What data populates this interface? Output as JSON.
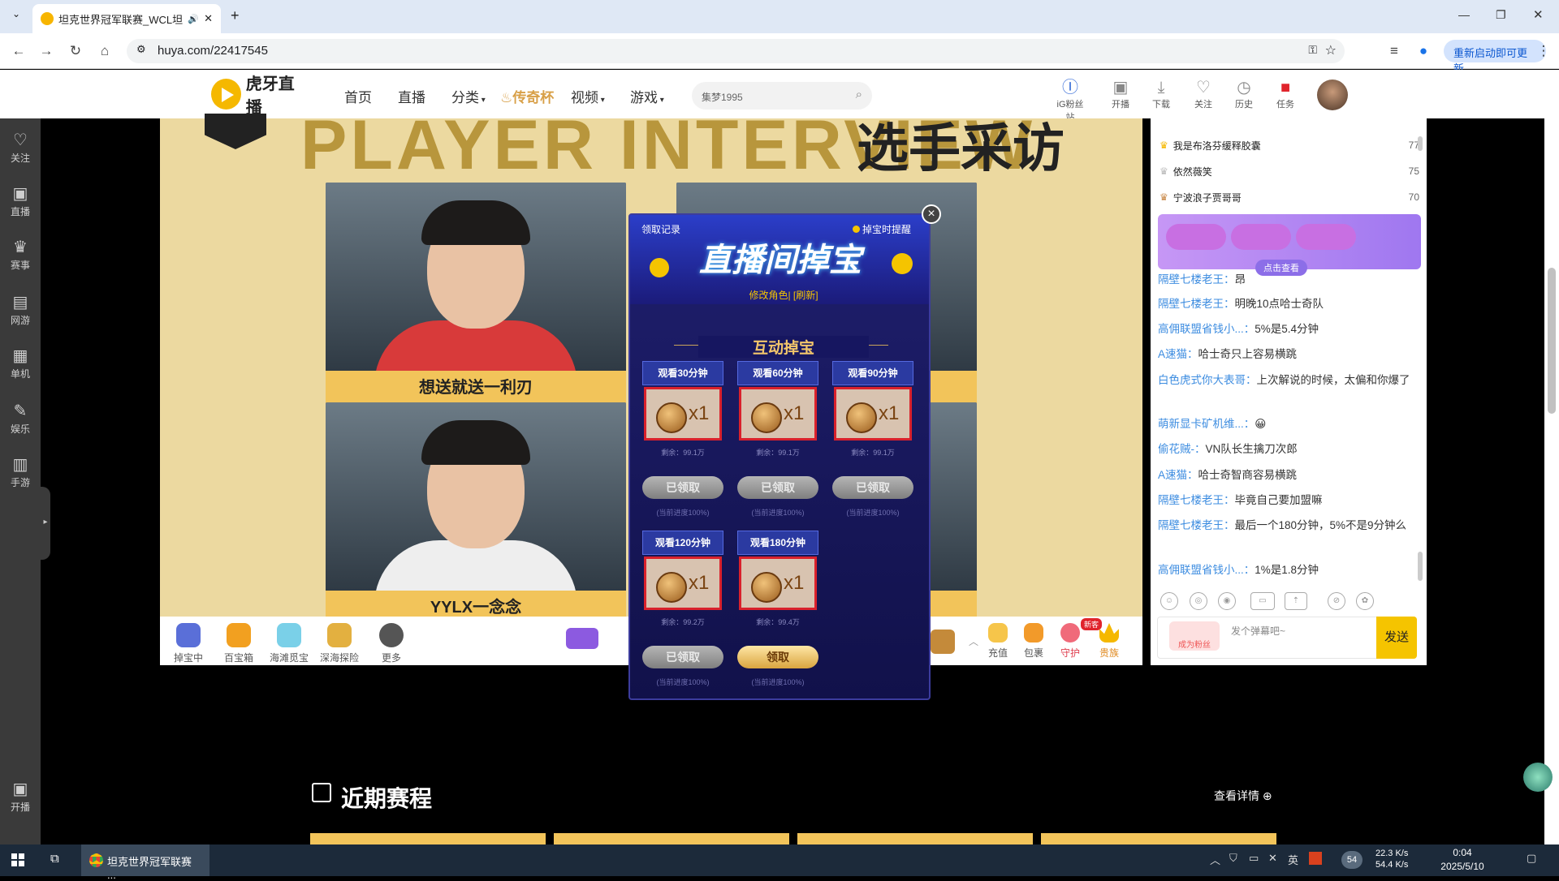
{
  "browser": {
    "tab_title": "坦克世界冠军联赛_WCL坦克",
    "url": "huya.com/22417545",
    "update_button": "重新启动即可更新"
  },
  "header": {
    "nav": [
      "首页",
      "直播",
      "分类",
      "传奇杯",
      "视频",
      "游戏"
    ],
    "search_placeholder": "集梦1995",
    "icons": [
      {
        "label": "iG粉丝站",
        "icon": "fan-icon"
      },
      {
        "label": "开播",
        "icon": "broadcast-icon"
      },
      {
        "label": "下载",
        "icon": "download-icon"
      },
      {
        "label": "关注",
        "icon": "heart-icon"
      },
      {
        "label": "历史",
        "icon": "history-icon"
      },
      {
        "label": "任务",
        "icon": "gift-icon"
      }
    ]
  },
  "sidebar": {
    "items": [
      {
        "label": "关注",
        "icon": "heart-icon"
      },
      {
        "label": "直播",
        "icon": "live-icon"
      },
      {
        "label": "赛事",
        "icon": "trophy-icon"
      },
      {
        "label": "网游",
        "icon": "gamepad-icon"
      },
      {
        "label": "单机",
        "icon": "console-icon"
      },
      {
        "label": "娱乐",
        "icon": "mic-icon"
      },
      {
        "label": "手游",
        "icon": "phone-game-icon"
      }
    ],
    "bottom": {
      "label": "开播",
      "icon": "broadcast-icon"
    }
  },
  "stage": {
    "cam1_caption": "想送就送一利刃",
    "cam2_caption": "YYLX一念念"
  },
  "giftbar": {
    "items": [
      "掉宝中",
      "百宝箱",
      "海滩觅宝",
      "深海探险",
      "更多"
    ],
    "right": [
      "充值",
      "包裹",
      "守护",
      "贵族"
    ],
    "new_badge": "新客"
  },
  "chat": {
    "rank": [
      {
        "name": "我是布洛芬缓释胶囊",
        "score": "77"
      },
      {
        "name": "依然薇笑",
        "score": "75"
      },
      {
        "name": "宁波浪子贾哥哥",
        "score": "70"
      }
    ],
    "promo_more": "点击查看",
    "messages": [
      {
        "user": "隔壁七楼老王：",
        "text": "昂"
      },
      {
        "user": "隔壁七楼老王：",
        "text": "明晚10点哈士奇队"
      },
      {
        "user": "高佣联盟省钱小...：",
        "text": "5%是5.4分钟"
      },
      {
        "user": "A速猫：",
        "text": "哈士奇只上容易横跳"
      },
      {
        "user": "白色虎式你大表哥：",
        "text": "上次解说的时候，太偏和你爆了"
      },
      {
        "user": "萌新显卡矿机维...：",
        "text": "😀"
      },
      {
        "user": "偷花贼-：",
        "text": "VN队长生擒刀次郎"
      },
      {
        "user": "A速猫：",
        "text": "哈士奇智商容易横跳"
      },
      {
        "user": "隔壁七楼老王：",
        "text": "毕竟自己要加盟嘛"
      },
      {
        "user": "隔壁七楼老王：",
        "text": "最后一个180分钟，5%不是9分钟么"
      },
      {
        "user": "高佣联盟省钱小...：",
        "text": "1%是1.8分钟"
      }
    ],
    "fan_badge": "成为粉丝",
    "input_placeholder": "发个弹幕吧~",
    "send": "发送"
  },
  "modal": {
    "record": "领取记录",
    "remind": "掉宝时提醒",
    "title": "直播间掉宝",
    "role": "修改角色| [刷新]",
    "subtitle": "互动掉宝",
    "cards": [
      {
        "label": "观看30分钟",
        "qty": "x1",
        "remain": "剩余：99.1万",
        "btn": "已领取",
        "status": "done",
        "progress": "(当前进度100%)"
      },
      {
        "label": "观看60分钟",
        "qty": "x1",
        "remain": "剩余：99.1万",
        "btn": "已领取",
        "status": "done",
        "progress": "(当前进度100%)"
      },
      {
        "label": "观看90分钟",
        "qty": "x1",
        "remain": "剩余：99.1万",
        "btn": "已领取",
        "status": "done",
        "progress": "(当前进度100%)"
      },
      {
        "label": "观看120分钟",
        "qty": "x1",
        "remain": "剩余：99.2万",
        "btn": "已领取",
        "status": "done",
        "progress": "(当前进度100%)"
      },
      {
        "label": "观看180分钟",
        "qty": "x1",
        "remain": "剩余：99.4万",
        "btn": "领取",
        "status": "go",
        "progress": "(当前进度100%)"
      }
    ]
  },
  "schedule": {
    "title": "近期赛程",
    "detail": "查看详情"
  },
  "taskbar": {
    "app": "坦克世界冠军联赛 ...",
    "cpu": "54",
    "up": "22.3 K/s",
    "down": "54.4 K/s",
    "time": "0:04",
    "date": "2025/5/10"
  }
}
